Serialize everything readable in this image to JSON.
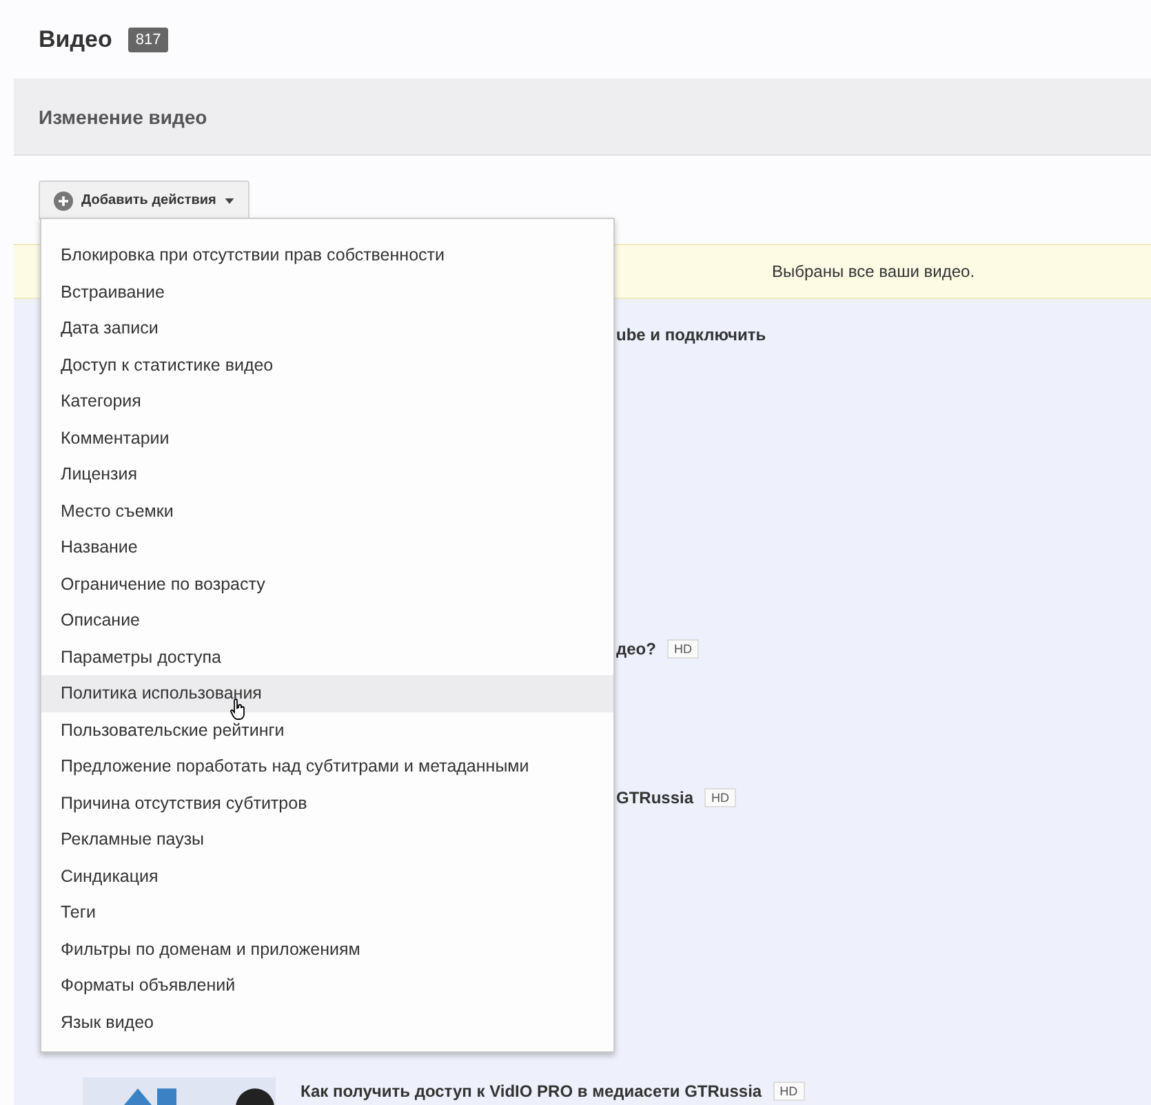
{
  "page": {
    "title": "Видео",
    "count": "817"
  },
  "edit_panel": {
    "title": "Изменение видео"
  },
  "actions_button": {
    "label": "Добавить действия"
  },
  "notice": "Выбраны все ваши видео.",
  "video_rows": [
    {
      "title": "ube и подключить",
      "thumbnail": false
    },
    {
      "title": "део?",
      "badge": "HD",
      "thumbnail": false
    },
    {
      "title": "GTRussia",
      "badge": "HD",
      "thumbnail": false
    },
    {
      "title": "Как получить доступ к VidIO PRO в медиасети GTRussia",
      "badge": "HD",
      "thumbnail": true
    }
  ],
  "dropdown": {
    "items": [
      {
        "label": "Блокировка при отсутствии прав собственности",
        "selected": false
      },
      {
        "label": "Встраивание",
        "selected": false
      },
      {
        "label": "Дата записи",
        "selected": false
      },
      {
        "label": "Доступ к статистике видео",
        "selected": false
      },
      {
        "label": "Категория",
        "selected": false
      },
      {
        "label": "Комментарии",
        "selected": false
      },
      {
        "label": "Лицензия",
        "selected": false
      },
      {
        "label": "Место съемки",
        "selected": false
      },
      {
        "label": "Название",
        "selected": false
      },
      {
        "label": "Ограничение по возрасту",
        "selected": false
      },
      {
        "label": "Описание",
        "selected": false
      },
      {
        "label": "Параметры доступа",
        "selected": false
      },
      {
        "label": "Политика использования",
        "selected": true
      },
      {
        "label": "Пользовательские рейтинги",
        "selected": false
      },
      {
        "label": "Предложение поработать над субтитрами и метаданными",
        "selected": false
      },
      {
        "label": "Причина отсутствия субтитров",
        "selected": false
      },
      {
        "label": "Рекламные паузы",
        "selected": false
      },
      {
        "label": "Синдикация",
        "selected": false
      },
      {
        "label": "Теги",
        "selected": false
      },
      {
        "label": "Фильтры по доменам и приложениям",
        "selected": false
      },
      {
        "label": "Форматы объявлений",
        "selected": false
      },
      {
        "label": "Язык видео",
        "selected": false
      }
    ]
  }
}
